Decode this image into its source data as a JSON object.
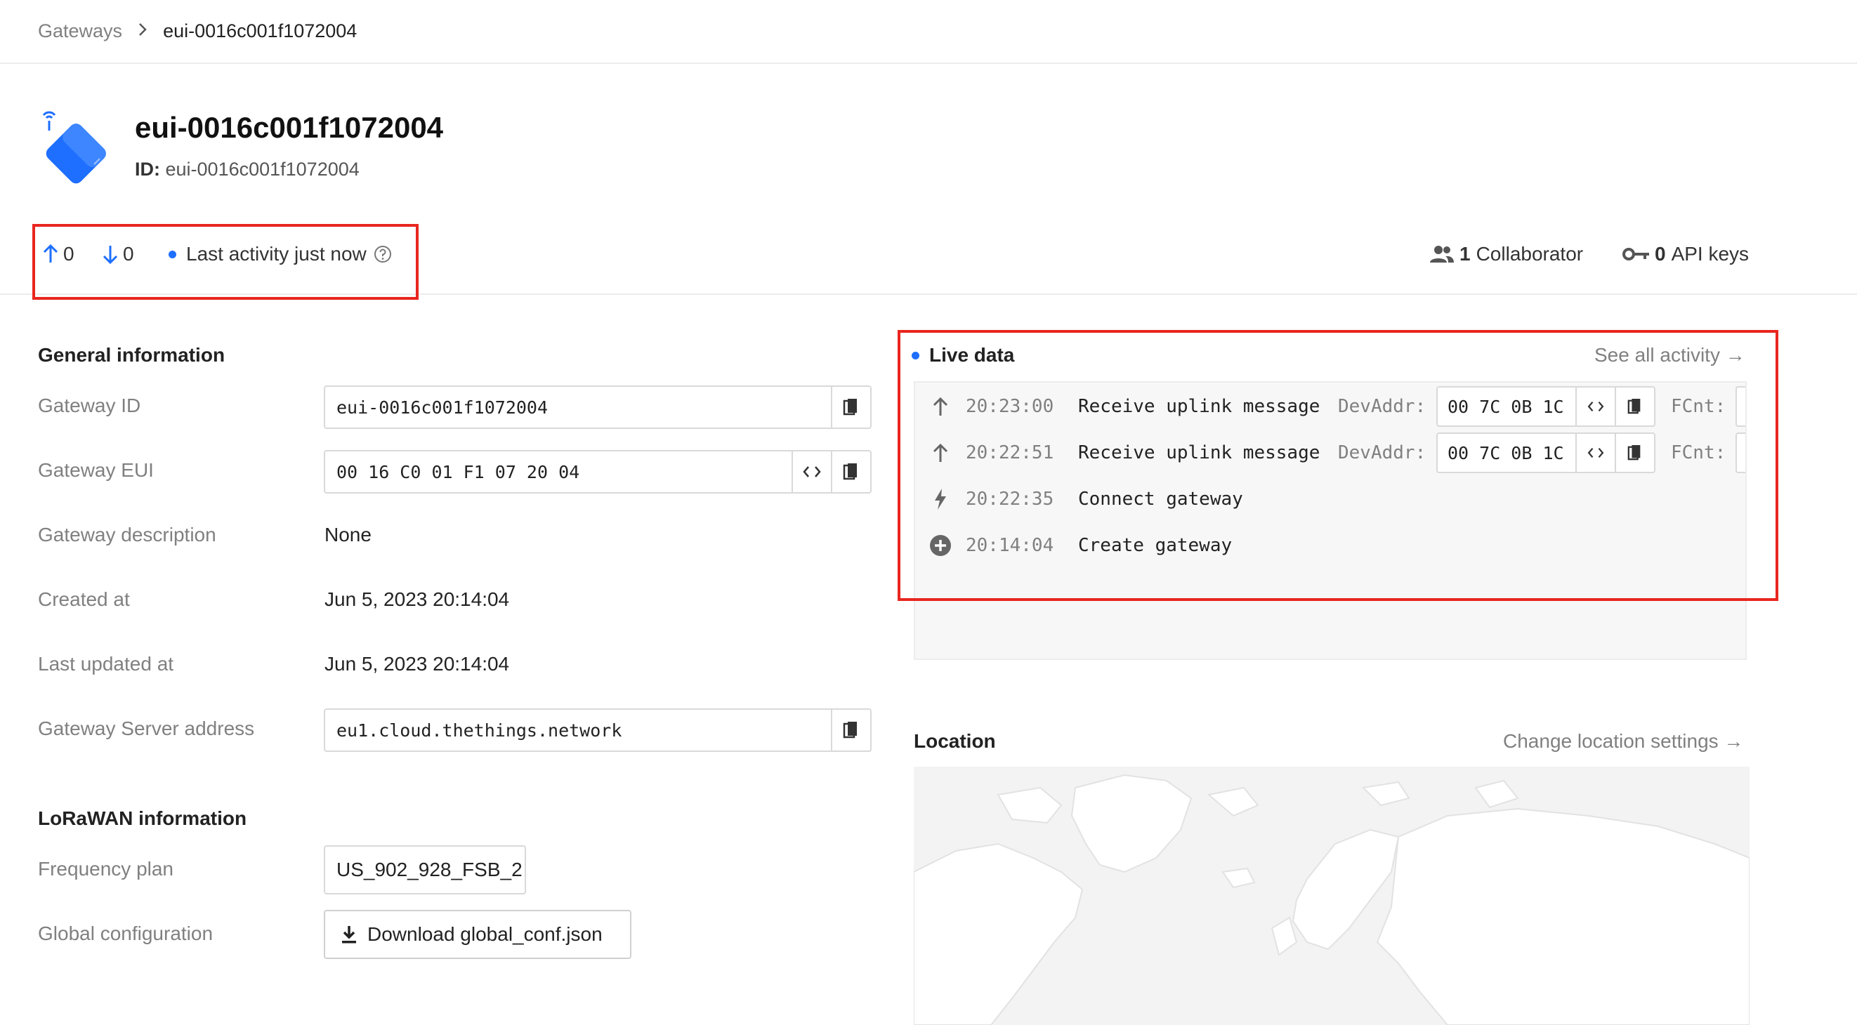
{
  "breadcrumb": {
    "parent": "Gateways",
    "separator": ">",
    "current": "eui-0016c001f1072004"
  },
  "header": {
    "title": "eui-0016c001f1072004",
    "id_label": "ID:",
    "id_value": "eui-0016c001f1072004"
  },
  "stats": {
    "uplink_count": "0",
    "downlink_count": "0",
    "last_activity": "Last activity just now",
    "collaborators_count": "1",
    "collaborators_label": "Collaborator",
    "api_keys_count": "0",
    "api_keys_label": "API keys"
  },
  "general": {
    "title": "General information",
    "gateway_id_label": "Gateway ID",
    "gateway_id": "eui-0016c001f1072004",
    "gateway_eui_label": "Gateway EUI",
    "gateway_eui": "00 16 C0 01 F1 07 20 04",
    "description_label": "Gateway description",
    "description": "None",
    "created_label": "Created at",
    "created": "Jun 5, 2023 20:14:04",
    "updated_label": "Last updated at",
    "updated": "Jun 5, 2023 20:14:04",
    "server_label": "Gateway Server address",
    "server": "eu1.cloud.thethings.network"
  },
  "lorawan": {
    "title": "LoRaWAN information",
    "freq_label": "Frequency plan",
    "freq": "US_902_928_FSB_2",
    "global_conf_label": "Global configuration",
    "download_label": "Download global_conf.json"
  },
  "live": {
    "title": "Live data",
    "see_all": "See all activity →",
    "events": [
      {
        "time": "20:23:00",
        "name": "Receive uplink message",
        "key": "DevAddr:",
        "value": "00 7C 0B 1C",
        "fcnt": "FCnt:"
      },
      {
        "time": "20:22:51",
        "name": "Receive uplink message",
        "key": "DevAddr:",
        "value": "00 7C 0B 1C",
        "fcnt": "FCnt:"
      },
      {
        "time": "20:22:35",
        "name": "Connect gateway"
      },
      {
        "time": "20:14:04",
        "name": "Create gateway"
      }
    ]
  },
  "location": {
    "title": "Location",
    "change": "Change location settings →"
  },
  "colors": {
    "accent": "#1e6fff",
    "highlight": "#e8261f",
    "muted": "#808080"
  }
}
